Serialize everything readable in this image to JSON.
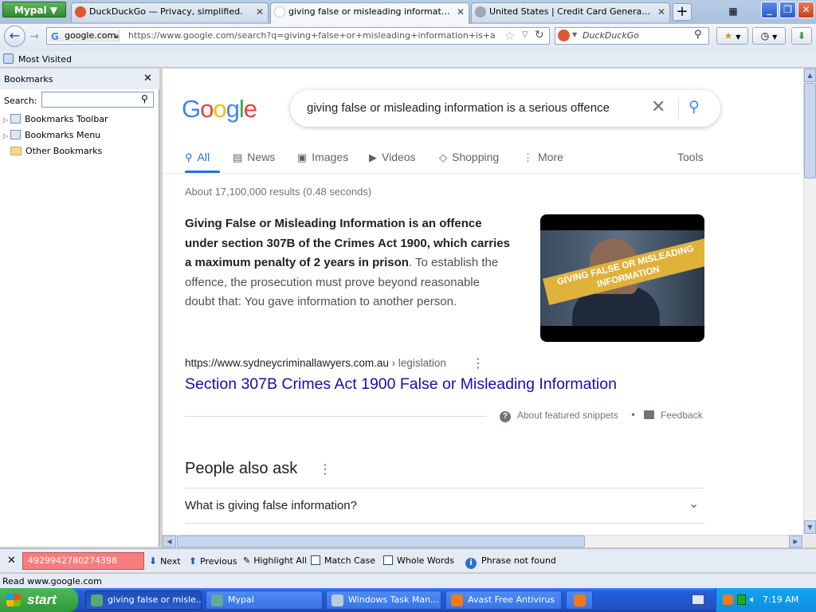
{
  "browser": {
    "app_menu": "Mypal",
    "tabs": [
      {
        "label": "DuckDuckGo — Privacy, simplified.",
        "active": false
      },
      {
        "label": "giving false or misleading information is a ...",
        "active": true
      },
      {
        "label": "United States | Credit Card Generator | V...",
        "active": false
      }
    ],
    "new_tab": "+",
    "nav": {
      "identity": "google.com",
      "url": "https://www.google.com/search?q=giving+false+or+misleading+information+is+a+serious+of",
      "search_engine_placeholder": "DuckDuckGo"
    },
    "bookmarks_toolbar": {
      "most_visited": "Most Visited"
    },
    "sidebar": {
      "title": "Bookmarks",
      "search_label": "Search:",
      "items": [
        "Bookmarks Toolbar",
        "Bookmarks Menu",
        "Other Bookmarks"
      ]
    },
    "findbar": {
      "query": "4929942780274398",
      "next": "Next",
      "previous": "Previous",
      "highlight_all": "Highlight All",
      "match_case": "Match Case",
      "whole_words": "Whole Words",
      "status": "Phrase not found"
    },
    "status": "Read www.google.com"
  },
  "google": {
    "logo": [
      "G",
      "o",
      "o",
      "g",
      "l",
      "e"
    ],
    "logo_colors": [
      "#4285f4",
      "#ea4335",
      "#fbbc05",
      "#4285f4",
      "#34a853",
      "#ea4335"
    ],
    "query": "giving false or misleading information is a serious offence",
    "tabs": [
      "All",
      "News",
      "Images",
      "Videos",
      "Shopping",
      "More"
    ],
    "tools": "Tools",
    "result_stats": "About 17,100,000 results (0.48 seconds)",
    "snippet_bold": "Giving False or Misleading Information is an offence under section 307B of the Crimes Act 1900, which carries a maximum penalty of 2 years in prison",
    "snippet_rest": ". To establish the offence, the prosecution must prove beyond reasonable doubt that: You gave information to another person.",
    "image_banner": "GIVING FALSE OR MISLEADING INFORMATION",
    "source_url": "https://www.sydneycriminallawyers.com.au",
    "source_crumb": "› legislation",
    "source_title": "Section 307B Crimes Act 1900 False or Misleading Information",
    "about_snippets": "About featured snippets",
    "feedback": "Feedback",
    "paa_title": "People also ask",
    "paa_questions": [
      "What is giving false information?"
    ]
  },
  "taskbar": {
    "start": "start",
    "tasks": [
      {
        "label": "giving false or misle...",
        "active": true
      },
      {
        "label": "Mypal",
        "active": false
      },
      {
        "label": "Windows Task Man...",
        "active": false
      },
      {
        "label": "Avast Free Antivirus",
        "active": false
      }
    ],
    "clock": "7:19 AM"
  }
}
